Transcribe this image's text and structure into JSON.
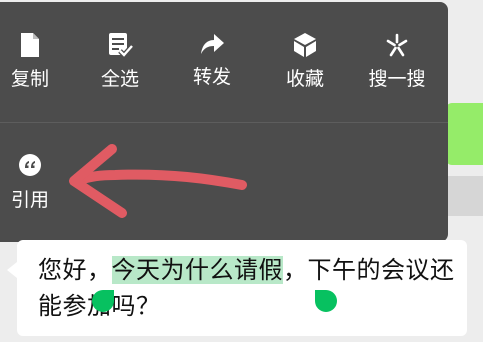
{
  "menu": {
    "items": [
      {
        "label": "复制",
        "icon": "document-icon"
      },
      {
        "label": "全选",
        "icon": "select-all-icon"
      },
      {
        "label": "转发",
        "icon": "forward-icon"
      },
      {
        "label": "收藏",
        "icon": "favorite-cube-icon"
      },
      {
        "label": "搜一搜",
        "icon": "search-sparkle-icon"
      }
    ],
    "quote": {
      "label": "引用",
      "icon": "quote-icon"
    }
  },
  "message": {
    "before": "您好，",
    "selected": "今天为什么请假",
    "after": "，下午的会议还能参加吗？"
  },
  "colors": {
    "menu_bg": "#4c4c4c",
    "selection": "#b8e8c8",
    "handle": "#07c160",
    "arrow": "#e05b63",
    "sent_bubble": "#95ec69"
  }
}
